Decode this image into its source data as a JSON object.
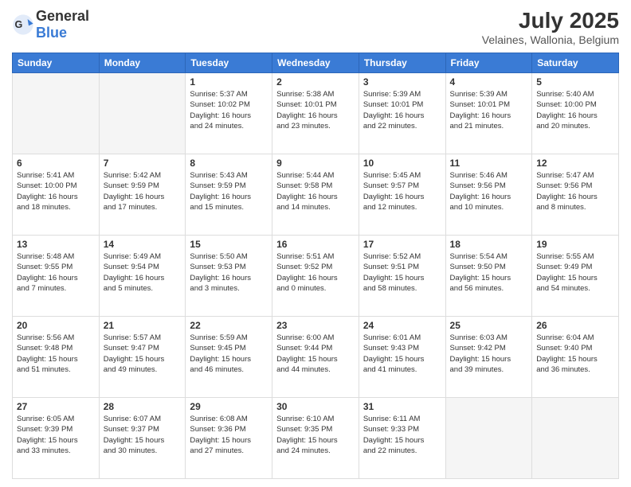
{
  "header": {
    "logo_general": "General",
    "logo_blue": "Blue",
    "title": "July 2025",
    "subtitle": "Velaines, Wallonia, Belgium"
  },
  "days_of_week": [
    "Sunday",
    "Monday",
    "Tuesday",
    "Wednesday",
    "Thursday",
    "Friday",
    "Saturday"
  ],
  "weeks": [
    [
      {
        "day": "",
        "info": ""
      },
      {
        "day": "",
        "info": ""
      },
      {
        "day": "1",
        "info": "Sunrise: 5:37 AM\nSunset: 10:02 PM\nDaylight: 16 hours\nand 24 minutes."
      },
      {
        "day": "2",
        "info": "Sunrise: 5:38 AM\nSunset: 10:01 PM\nDaylight: 16 hours\nand 23 minutes."
      },
      {
        "day": "3",
        "info": "Sunrise: 5:39 AM\nSunset: 10:01 PM\nDaylight: 16 hours\nand 22 minutes."
      },
      {
        "day": "4",
        "info": "Sunrise: 5:39 AM\nSunset: 10:01 PM\nDaylight: 16 hours\nand 21 minutes."
      },
      {
        "day": "5",
        "info": "Sunrise: 5:40 AM\nSunset: 10:00 PM\nDaylight: 16 hours\nand 20 minutes."
      }
    ],
    [
      {
        "day": "6",
        "info": "Sunrise: 5:41 AM\nSunset: 10:00 PM\nDaylight: 16 hours\nand 18 minutes."
      },
      {
        "day": "7",
        "info": "Sunrise: 5:42 AM\nSunset: 9:59 PM\nDaylight: 16 hours\nand 17 minutes."
      },
      {
        "day": "8",
        "info": "Sunrise: 5:43 AM\nSunset: 9:59 PM\nDaylight: 16 hours\nand 15 minutes."
      },
      {
        "day": "9",
        "info": "Sunrise: 5:44 AM\nSunset: 9:58 PM\nDaylight: 16 hours\nand 14 minutes."
      },
      {
        "day": "10",
        "info": "Sunrise: 5:45 AM\nSunset: 9:57 PM\nDaylight: 16 hours\nand 12 minutes."
      },
      {
        "day": "11",
        "info": "Sunrise: 5:46 AM\nSunset: 9:56 PM\nDaylight: 16 hours\nand 10 minutes."
      },
      {
        "day": "12",
        "info": "Sunrise: 5:47 AM\nSunset: 9:56 PM\nDaylight: 16 hours\nand 8 minutes."
      }
    ],
    [
      {
        "day": "13",
        "info": "Sunrise: 5:48 AM\nSunset: 9:55 PM\nDaylight: 16 hours\nand 7 minutes."
      },
      {
        "day": "14",
        "info": "Sunrise: 5:49 AM\nSunset: 9:54 PM\nDaylight: 16 hours\nand 5 minutes."
      },
      {
        "day": "15",
        "info": "Sunrise: 5:50 AM\nSunset: 9:53 PM\nDaylight: 16 hours\nand 3 minutes."
      },
      {
        "day": "16",
        "info": "Sunrise: 5:51 AM\nSunset: 9:52 PM\nDaylight: 16 hours\nand 0 minutes."
      },
      {
        "day": "17",
        "info": "Sunrise: 5:52 AM\nSunset: 9:51 PM\nDaylight: 15 hours\nand 58 minutes."
      },
      {
        "day": "18",
        "info": "Sunrise: 5:54 AM\nSunset: 9:50 PM\nDaylight: 15 hours\nand 56 minutes."
      },
      {
        "day": "19",
        "info": "Sunrise: 5:55 AM\nSunset: 9:49 PM\nDaylight: 15 hours\nand 54 minutes."
      }
    ],
    [
      {
        "day": "20",
        "info": "Sunrise: 5:56 AM\nSunset: 9:48 PM\nDaylight: 15 hours\nand 51 minutes."
      },
      {
        "day": "21",
        "info": "Sunrise: 5:57 AM\nSunset: 9:47 PM\nDaylight: 15 hours\nand 49 minutes."
      },
      {
        "day": "22",
        "info": "Sunrise: 5:59 AM\nSunset: 9:45 PM\nDaylight: 15 hours\nand 46 minutes."
      },
      {
        "day": "23",
        "info": "Sunrise: 6:00 AM\nSunset: 9:44 PM\nDaylight: 15 hours\nand 44 minutes."
      },
      {
        "day": "24",
        "info": "Sunrise: 6:01 AM\nSunset: 9:43 PM\nDaylight: 15 hours\nand 41 minutes."
      },
      {
        "day": "25",
        "info": "Sunrise: 6:03 AM\nSunset: 9:42 PM\nDaylight: 15 hours\nand 39 minutes."
      },
      {
        "day": "26",
        "info": "Sunrise: 6:04 AM\nSunset: 9:40 PM\nDaylight: 15 hours\nand 36 minutes."
      }
    ],
    [
      {
        "day": "27",
        "info": "Sunrise: 6:05 AM\nSunset: 9:39 PM\nDaylight: 15 hours\nand 33 minutes."
      },
      {
        "day": "28",
        "info": "Sunrise: 6:07 AM\nSunset: 9:37 PM\nDaylight: 15 hours\nand 30 minutes."
      },
      {
        "day": "29",
        "info": "Sunrise: 6:08 AM\nSunset: 9:36 PM\nDaylight: 15 hours\nand 27 minutes."
      },
      {
        "day": "30",
        "info": "Sunrise: 6:10 AM\nSunset: 9:35 PM\nDaylight: 15 hours\nand 24 minutes."
      },
      {
        "day": "31",
        "info": "Sunrise: 6:11 AM\nSunset: 9:33 PM\nDaylight: 15 hours\nand 22 minutes."
      },
      {
        "day": "",
        "info": ""
      },
      {
        "day": "",
        "info": ""
      }
    ]
  ]
}
